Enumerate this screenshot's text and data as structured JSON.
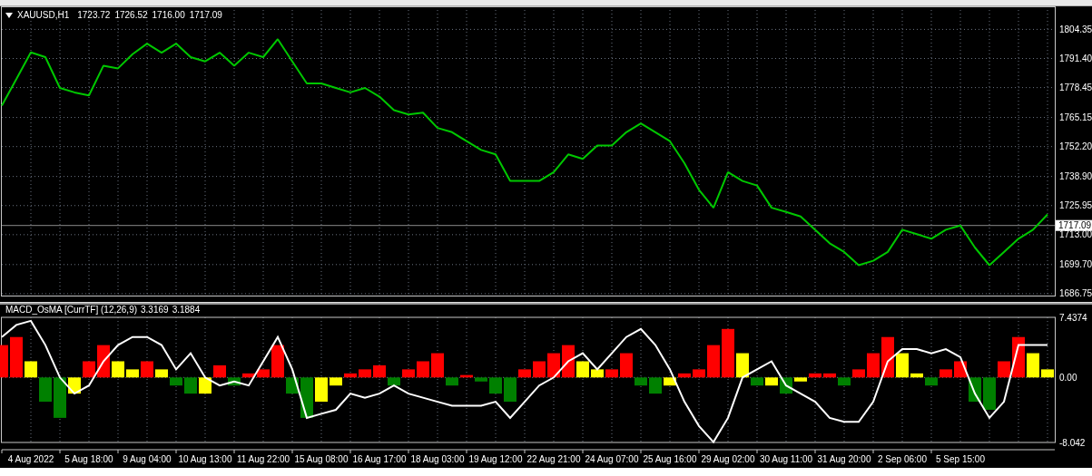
{
  "price_panel": {
    "symbol": "XAUUSD,H1",
    "ohlc": [
      "1723.72",
      "1726.52",
      "1716.00",
      "1717.09"
    ],
    "chart_data": {
      "type": "line",
      "grid": true,
      "ylim": [
        1685.5,
        1814.6
      ],
      "yticks": [
        {
          "value": 1804.35,
          "label": "1804.35"
        },
        {
          "value": 1791.4,
          "label": "1791.40"
        },
        {
          "value": 1778.45,
          "label": "1778.45"
        },
        {
          "value": 1765.15,
          "label": "1765.15"
        },
        {
          "value": 1752.2,
          "label": "1752.20"
        },
        {
          "value": 1738.9,
          "label": "1738.90"
        },
        {
          "value": 1725.95,
          "label": "1725.95"
        },
        {
          "value": 1713.0,
          "label": "1713.00"
        },
        {
          "value": 1699.7,
          "label": "1699.70"
        },
        {
          "value": 1686.75,
          "label": "1686.75"
        }
      ],
      "ref_lines": [
        {
          "axis": "y",
          "value": 1717.09,
          "label": "1717.09",
          "color": "#8a8a8a"
        }
      ],
      "series": [
        {
          "color": "#00c800",
          "values": [
            1770.4,
            1782.2,
            1794.1,
            1792,
            1778.3,
            1776.3,
            1775,
            1788.2,
            1787,
            1793.3,
            1798,
            1794,
            1798,
            1792,
            1790.1,
            1794,
            1788.2,
            1794,
            1792,
            1800,
            1790.1,
            1780.3,
            1780.3,
            1778.3,
            1776.3,
            1778.3,
            1774.4,
            1768.4,
            1766.5,
            1767.3,
            1760.5,
            1758.6,
            1754.6,
            1750.7,
            1748.7,
            1736.9,
            1736.9,
            1736.9,
            1740.8,
            1748.7,
            1746.7,
            1752.7,
            1752.7,
            1758.6,
            1762.5,
            1758.6,
            1754.6,
            1744.8,
            1733,
            1725,
            1740.8,
            1736.9,
            1734.9,
            1725,
            1723.1,
            1721.1,
            1715.2,
            1709.2,
            1705.3,
            1699.4,
            1701.4,
            1705.3,
            1715.2,
            1713.2,
            1711.2,
            1715.2,
            1717.1,
            1707.3,
            1699.4,
            1705.3,
            1711.2,
            1715.2,
            1722
          ]
        }
      ]
    }
  },
  "indicator_panel": {
    "title": "MACD_OsMA [CurrTF] (12,26,9)",
    "readings": [
      "3.3169",
      "3.1884"
    ],
    "chart_data": {
      "type": "bar",
      "grid": true,
      "stacked": true,
      "ylim": [
        -8.042,
        7.4374
      ],
      "yticks": [
        {
          "value": 7.4374,
          "label": "7.4374"
        },
        {
          "value": 0,
          "label": "0.00"
        },
        {
          "value": -8.042,
          "label": "-8.042"
        }
      ],
      "categories": [
        null,
        null,
        "4 Aug 2022",
        null,
        null,
        null,
        "5 Aug 18:00",
        null,
        null,
        null,
        "9 Aug 04:00",
        null,
        null,
        null,
        "10 Aug 13:00",
        null,
        null,
        null,
        "11 Aug 22:00",
        null,
        null,
        null,
        "15 Aug 08:00",
        null,
        null,
        null,
        "16 Aug 17:00",
        null,
        null,
        null,
        "18 Aug 03:00",
        null,
        null,
        null,
        "19 Aug 12:00",
        null,
        null,
        null,
        "22 Aug 21:00",
        null,
        null,
        null,
        "24 Aug 07:00",
        null,
        null,
        null,
        "25 Aug 16:00",
        null,
        null,
        null,
        "29 Aug 02:00",
        null,
        null,
        null,
        "30 Aug 11:00",
        null,
        null,
        null,
        "31 Aug 20:00",
        null,
        null,
        null,
        "2 Sep 06:00",
        null,
        null,
        null,
        "5 Sep 15:00",
        null,
        null,
        null,
        null,
        null,
        null
      ],
      "series": [
        {
          "color": "#ff0000",
          "values": [
            4,
            5,
            null,
            null,
            null,
            null,
            2,
            4,
            null,
            null,
            2,
            null,
            null,
            null,
            null,
            1.5,
            null,
            0.5,
            1,
            4,
            null,
            null,
            null,
            null,
            0.5,
            1,
            1.5,
            null,
            1,
            2,
            3,
            null,
            0.3,
            null,
            null,
            null,
            1,
            2,
            3,
            4,
            null,
            null,
            1,
            3,
            null,
            null,
            null,
            0.5,
            1,
            4,
            6,
            null,
            null,
            null,
            null,
            null,
            0.5,
            0.5,
            null,
            1,
            3,
            5,
            null,
            null,
            null,
            1,
            2,
            null,
            null,
            2,
            5,
            null,
            null
          ]
        },
        {
          "color": "#ffff00",
          "values": [
            null,
            null,
            2,
            null,
            null,
            -2,
            null,
            null,
            2,
            1,
            null,
            1,
            null,
            null,
            -2,
            null,
            null,
            null,
            null,
            null,
            null,
            null,
            -3,
            -1,
            null,
            null,
            null,
            null,
            null,
            null,
            null,
            null,
            null,
            null,
            null,
            null,
            null,
            null,
            null,
            null,
            2,
            1,
            null,
            null,
            null,
            null,
            -1,
            null,
            null,
            null,
            null,
            3,
            null,
            -1,
            null,
            -0.5,
            null,
            null,
            null,
            null,
            null,
            null,
            3,
            0.5,
            null,
            null,
            null,
            null,
            null,
            null,
            null,
            3,
            1
          ]
        },
        {
          "color": "#008000",
          "values": [
            null,
            null,
            null,
            -3,
            -5,
            null,
            null,
            null,
            null,
            null,
            null,
            null,
            -1,
            -2,
            null,
            null,
            -1,
            null,
            null,
            null,
            -2,
            -5,
            null,
            null,
            null,
            null,
            null,
            -1,
            null,
            null,
            null,
            -1,
            null,
            -0.5,
            -2,
            -3,
            null,
            null,
            null,
            null,
            null,
            null,
            null,
            null,
            -1,
            -2,
            null,
            null,
            null,
            null,
            null,
            null,
            -1,
            null,
            -2,
            null,
            null,
            null,
            -1,
            null,
            null,
            null,
            null,
            null,
            -1,
            null,
            null,
            -3,
            -4,
            null,
            null,
            null,
            null
          ]
        },
        {
          "type": "line",
          "color": "#ffffff",
          "values": [
            5,
            6.5,
            7,
            4,
            0,
            -2,
            -1,
            2,
            4,
            5,
            5,
            4,
            1,
            3,
            0,
            -1,
            -0.5,
            -1,
            2,
            5,
            1,
            -5,
            -4.5,
            -4,
            -2,
            -2.5,
            -2,
            -1,
            -2,
            -2.5,
            -3,
            -3.5,
            -3.5,
            -3.5,
            -3,
            -5,
            -3,
            -1,
            0,
            2,
            3,
            1,
            3,
            5,
            6,
            4,
            1,
            -3,
            -6,
            -8,
            -5,
            0,
            1,
            2,
            -1,
            -2,
            -3,
            -5,
            -5.5,
            -5.5,
            -3,
            2,
            3.5,
            3.5,
            3,
            3.5,
            2.5,
            -2,
            -5,
            -3,
            4,
            4,
            4
          ]
        }
      ]
    }
  }
}
